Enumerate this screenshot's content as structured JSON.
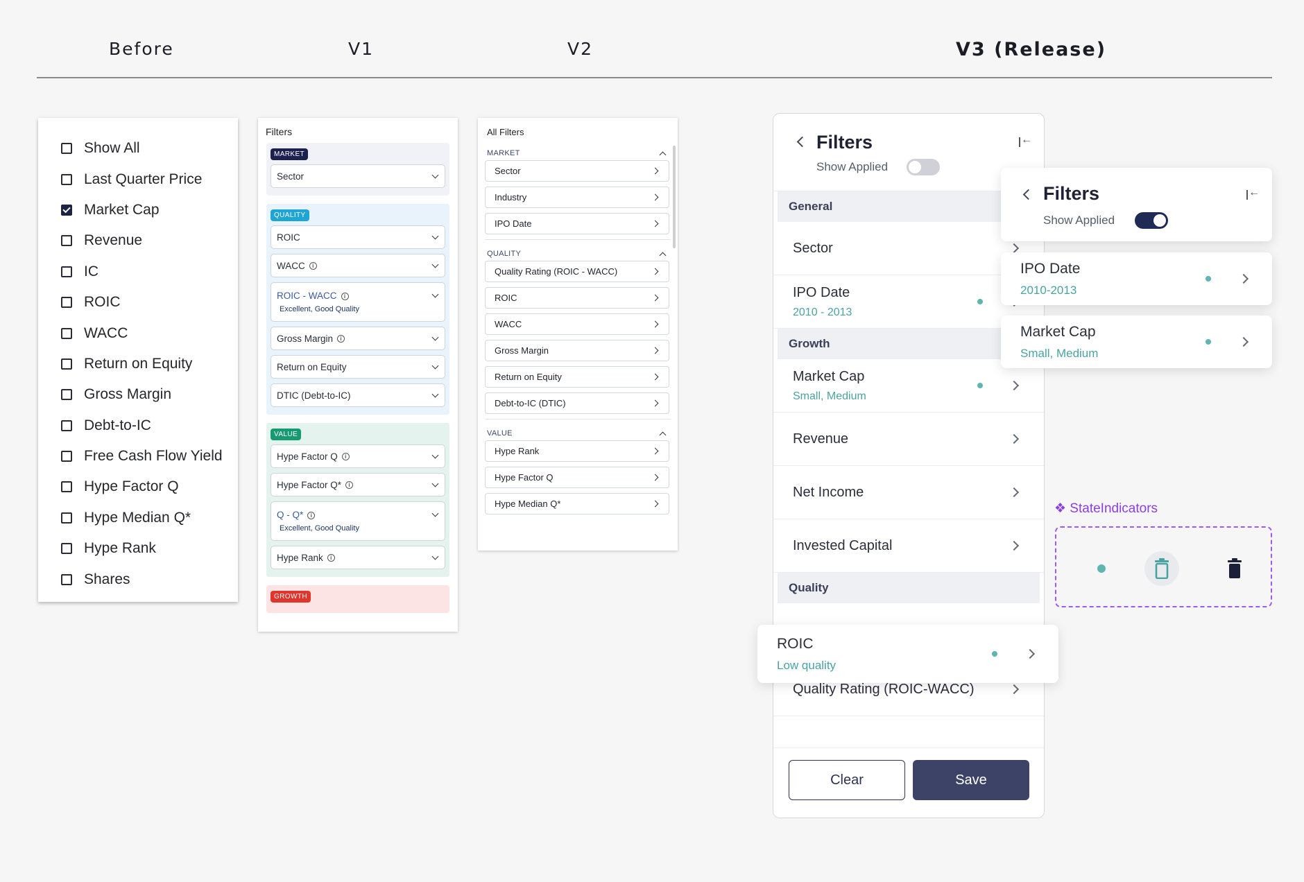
{
  "headers": {
    "before": "Before",
    "v1": "V1",
    "v2": "V2",
    "v3": "V3 (Release)"
  },
  "before": {
    "items": [
      {
        "label": "Show All",
        "checked": false
      },
      {
        "label": "Last Quarter Price",
        "checked": false
      },
      {
        "label": "Market Cap",
        "checked": true
      },
      {
        "label": "Revenue",
        "checked": false
      },
      {
        "label": "IC",
        "checked": false
      },
      {
        "label": "ROIC",
        "checked": false
      },
      {
        "label": "WACC",
        "checked": false
      },
      {
        "label": "Return on Equity",
        "checked": false
      },
      {
        "label": "Gross Margin",
        "checked": false
      },
      {
        "label": "Debt-to-IC",
        "checked": false
      },
      {
        "label": "Free Cash Flow Yield",
        "checked": false
      },
      {
        "label": "Hype Factor Q",
        "checked": false
      },
      {
        "label": "Hype Median Q*",
        "checked": false
      },
      {
        "label": "Hype Rank",
        "checked": false
      },
      {
        "label": "Shares",
        "checked": false
      }
    ]
  },
  "v1": {
    "title": "Filters",
    "market": {
      "badge": "MARKET",
      "color": "#1c2150",
      "items": [
        "Sector"
      ]
    },
    "quality": {
      "badge": "QUALITY",
      "color": "#1fa4d6",
      "items": [
        "ROIC",
        "WACC",
        "ROIC - WACC",
        "Gross Margin",
        "Return on Equity",
        "DTIC (Debt-to-IC)"
      ],
      "roic_wacc_sub": "Excellent, Good Quality"
    },
    "value": {
      "badge": "VALUE",
      "color": "#179a72",
      "items": [
        "Hype Factor Q",
        "Hype Factor Q*",
        "Q - Q*",
        "Hype Rank"
      ],
      "q_sub": "Excellent, Good Quality"
    },
    "growth": {
      "badge": "GROWTH",
      "color": "#e0352b"
    }
  },
  "v2": {
    "title": "All Filters",
    "market": {
      "label": "MARKET",
      "items": [
        "Sector",
        "Industry",
        "IPO Date"
      ]
    },
    "quality": {
      "label": "QUALITY",
      "items": [
        "Quality Rating (ROIC - WACC)",
        "ROIC",
        "WACC",
        "Gross Margin",
        "Return on Equity",
        "Debt-to-IC (DTIC)"
      ]
    },
    "value": {
      "label": "VALUE",
      "items": [
        "Hype Rank",
        "Hype Factor Q",
        "Hype Median Q*"
      ]
    }
  },
  "v3": {
    "title": "Filters",
    "show_applied": "Show Applied",
    "sections": {
      "general": "General",
      "growth": "Growth",
      "quality": "Quality"
    },
    "rows": {
      "sector": "Sector",
      "ipo": {
        "label": "IPO Date",
        "value": "2010 - 2013"
      },
      "mcap": {
        "label": "Market Cap",
        "value": "Small, Medium"
      },
      "revenue": "Revenue",
      "net_income": "Net Income",
      "invested_capital": "Invested Capital",
      "quality_rating": "Quality Rating (ROIC-WACC)"
    },
    "roic_card": {
      "label": "ROIC",
      "value": "Low quality"
    },
    "buttons": {
      "clear": "Clear",
      "save": "Save"
    },
    "applied_panel": {
      "title": "Filters",
      "show_applied": "Show Applied",
      "ipo": {
        "label": "IPO Date",
        "value": "2010-2013"
      },
      "mcap": {
        "label": "Market Cap",
        "value": "Small, Medium"
      }
    },
    "state_indicators": "❖ StateIndicators"
  }
}
